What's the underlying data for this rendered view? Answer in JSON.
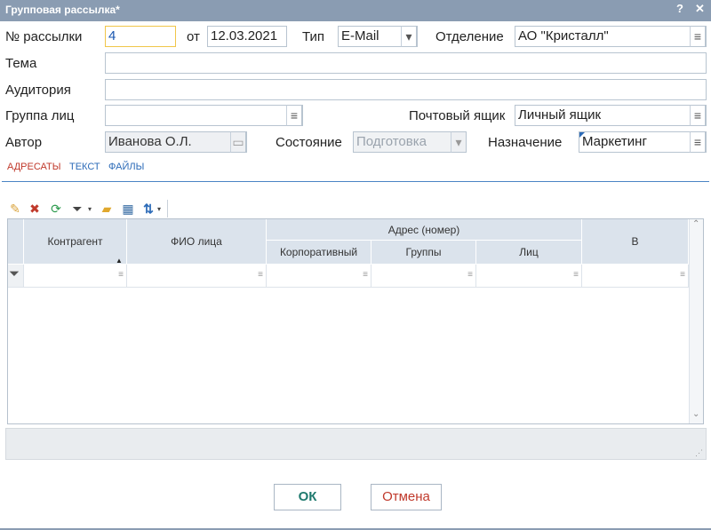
{
  "window": {
    "title": "Групповая рассылка*",
    "help": "?",
    "close": "✕"
  },
  "form": {
    "number_label": "№ рассылки",
    "number_value": "4",
    "from_label": "от",
    "date_value": "12.03.2021",
    "type_label": "Тип",
    "type_value": "E-Mail",
    "department_label": "Отделение",
    "department_value": "АО \"Кристалл\"",
    "subject_label": "Тема",
    "subject_value": "",
    "audience_label": "Аудитория",
    "audience_value": "",
    "group_label": "Группа лиц",
    "group_value": "",
    "mailbox_label": "Почтовый ящик",
    "mailbox_value": "Личный ящик",
    "author_label": "Автор",
    "author_value": "Иванова О.Л.",
    "state_label": "Состояние",
    "state_value": "Подготовка",
    "purpose_label": "Назначение",
    "purpose_value": "Маркетинг"
  },
  "tabs": [
    "АДРЕСАТЫ",
    "ТЕКСТ",
    "ФАЙЛЫ"
  ],
  "toolbar_icons": [
    "new-document-icon",
    "delete-document-icon",
    "refresh-icon",
    "filter-icon",
    "folder-icon",
    "grid-layout-icon",
    "sort-icon"
  ],
  "grid": {
    "headers": {
      "contractor": "Контрагент",
      "person": "ФИО лица",
      "address_group": "Адрес (номер)",
      "corporate": "Корпоративный",
      "groups": "Группы",
      "personal": "Лиц",
      "b": "В"
    },
    "rows": []
  },
  "buttons": {
    "ok": "ОК",
    "cancel": "Отмена"
  },
  "colors": {
    "titlebar": "#8a9cb2",
    "accent": "#2c6bb8",
    "active_tab": "#c0392b",
    "ok_text": "#1f7a6e"
  }
}
